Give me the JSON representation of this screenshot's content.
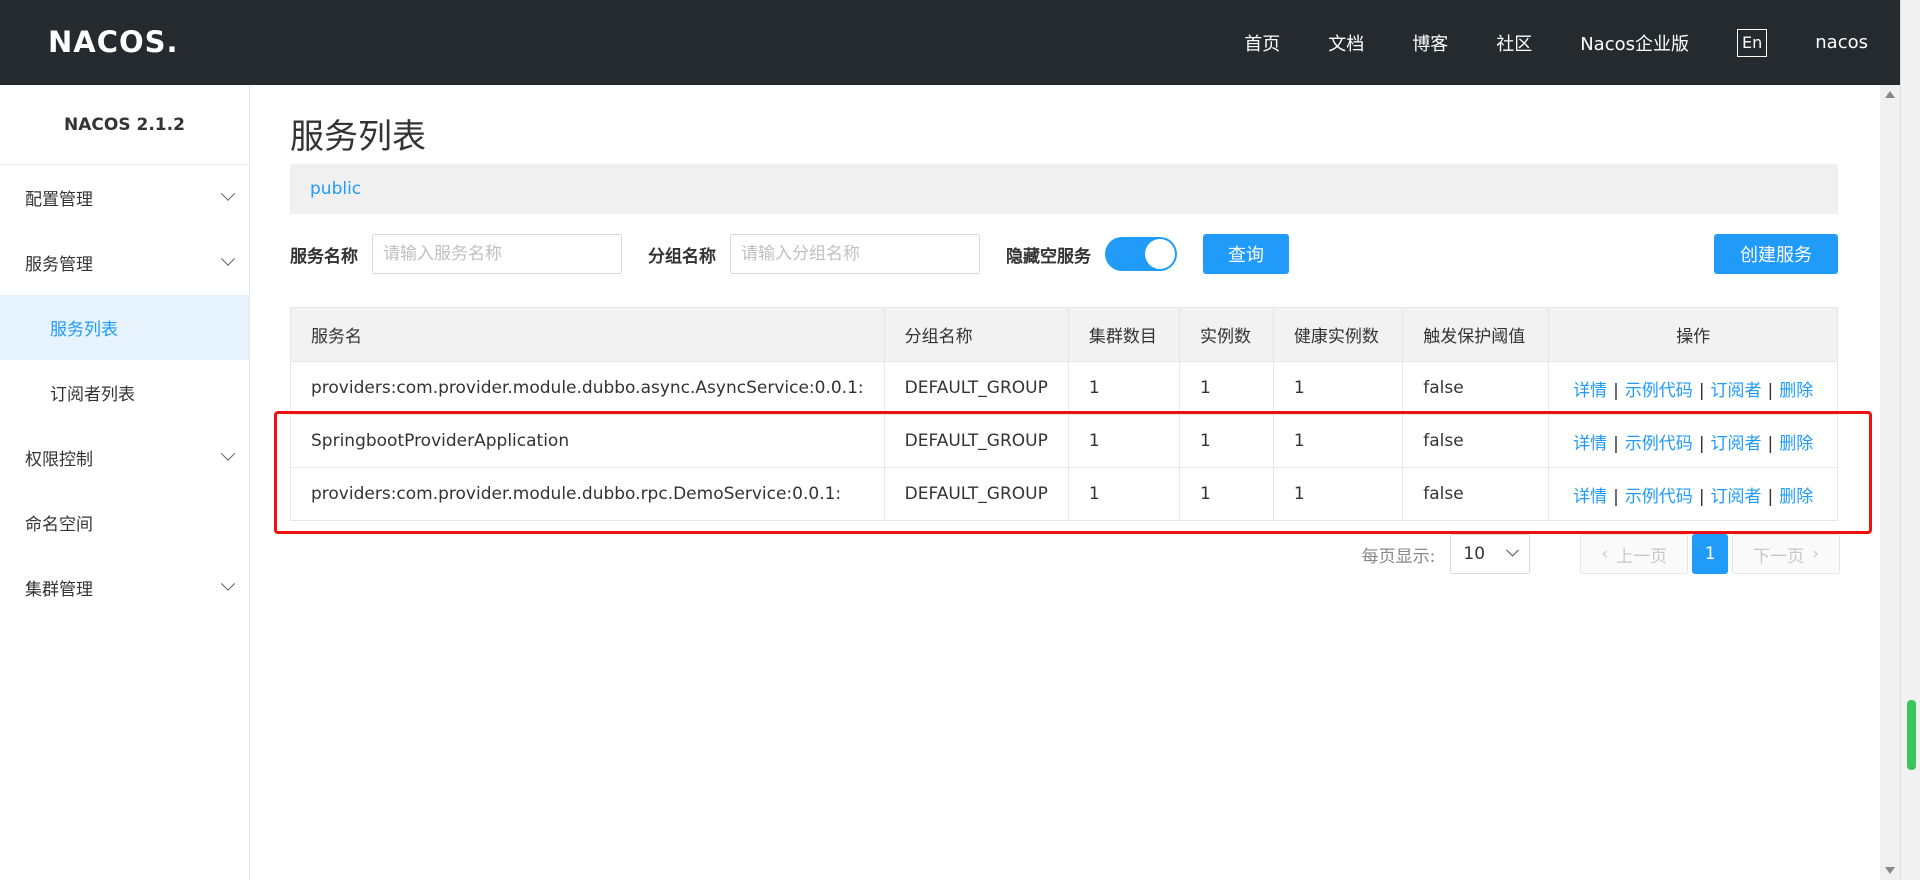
{
  "header": {
    "logo_text": "NACOS.",
    "nav": [
      "首页",
      "文档",
      "博客",
      "社区",
      "Nacos企业版"
    ],
    "lang": "En",
    "user": "nacos"
  },
  "sidebar": {
    "version": "NACOS 2.1.2",
    "items": [
      {
        "label": "配置管理",
        "expandable": true
      },
      {
        "label": "服务管理",
        "expandable": true
      },
      {
        "label": "服务列表",
        "sub": true,
        "active": true
      },
      {
        "label": "订阅者列表",
        "sub": true
      },
      {
        "label": "权限控制",
        "expandable": true
      },
      {
        "label": "命名空间"
      },
      {
        "label": "集群管理",
        "expandable": true
      }
    ]
  },
  "main": {
    "title": "服务列表",
    "namespace": "public",
    "filters": {
      "service_label": "服务名称",
      "service_placeholder": "请输入服务名称",
      "group_label": "分组名称",
      "group_placeholder": "请输入分组名称",
      "hide_empty_label": "隐藏空服务",
      "hide_empty_on": true,
      "query_button": "查询",
      "create_button": "创建服务"
    },
    "table": {
      "headers": [
        "服务名",
        "分组名称",
        "集群数目",
        "实例数",
        "健康实例数",
        "触发保护阈值",
        "操作"
      ],
      "rows": [
        {
          "name": "providers:com.provider.module.dubbo.async.AsyncService:0.0.1:",
          "group": "DEFAULT_GROUP",
          "clusters": "1",
          "instances": "1",
          "healthy": "1",
          "threshold": "false"
        },
        {
          "name": "SpringbootProviderApplication",
          "group": "DEFAULT_GROUP",
          "clusters": "1",
          "instances": "1",
          "healthy": "1",
          "threshold": "false"
        },
        {
          "name": "providers:com.provider.module.dubbo.rpc.DemoService:0.0.1:",
          "group": "DEFAULT_GROUP",
          "clusters": "1",
          "instances": "1",
          "healthy": "1",
          "threshold": "false"
        }
      ],
      "ops": {
        "detail": "详情",
        "sample": "示例代码",
        "subscriber": "订阅者",
        "delete": "删除",
        "separator": "|"
      }
    },
    "pagination": {
      "page_size_label": "每页显示:",
      "page_size": "10",
      "prev": "上一页",
      "next": "下一页",
      "current_page": "1"
    }
  },
  "colors": {
    "accent": "#209bfa",
    "header_bg": "#252a2f",
    "highlight": "#ee1111"
  }
}
